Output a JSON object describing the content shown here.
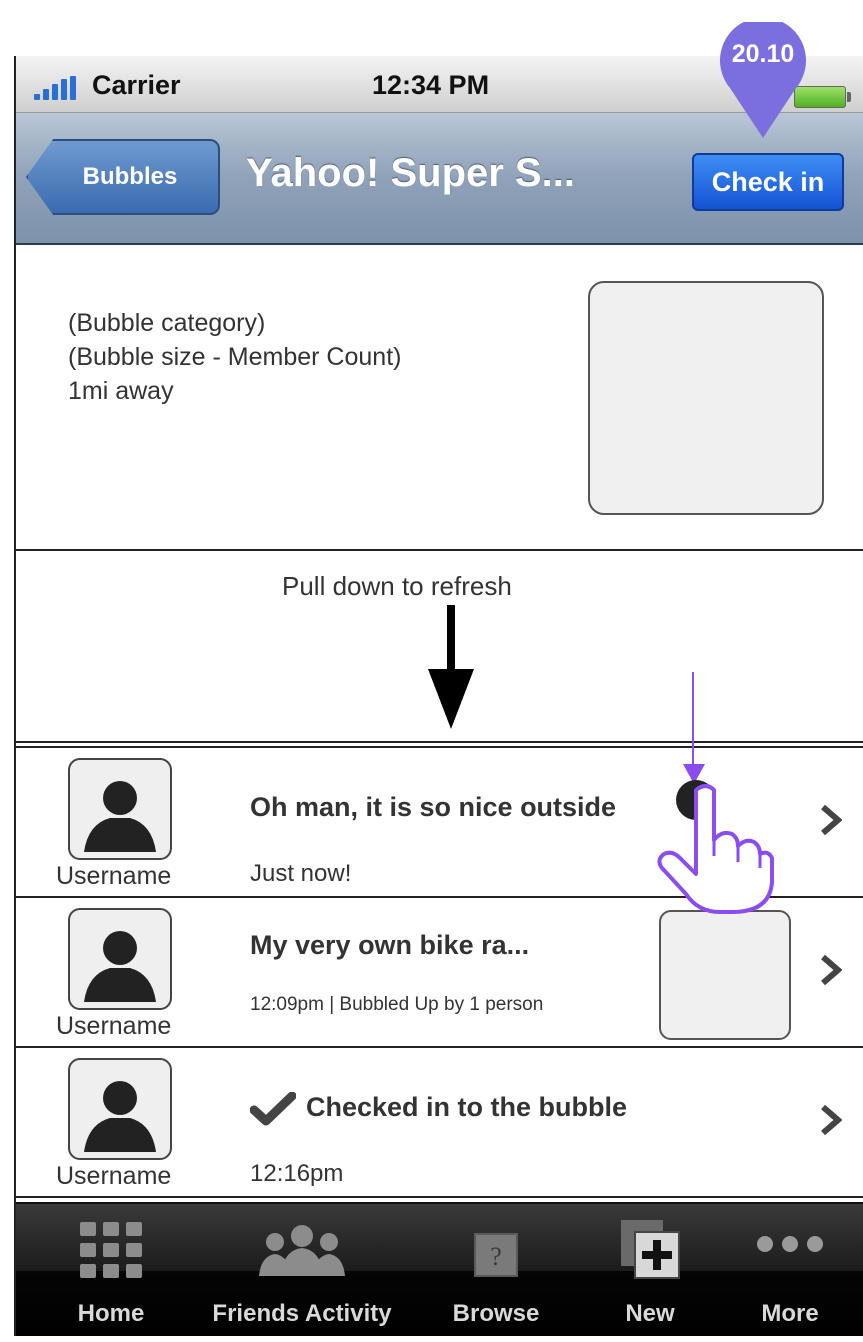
{
  "status_bar": {
    "carrier": "Carrier",
    "time": "12:34 PM",
    "signal_icon": "signal-bars-icon",
    "battery_icon": "battery-icon"
  },
  "nav_bar": {
    "back_label": "Bubbles",
    "title": "Yahoo! Super S...",
    "checkin_label": "Check in"
  },
  "bubble_info": {
    "category": "(Bubble category)",
    "size": "(Bubble size - Member Count)",
    "distance": "1mi away"
  },
  "refresh": {
    "label": "Pull down to refresh",
    "icon": "arrow-down-icon"
  },
  "feed": [
    {
      "username": "Username",
      "title": "Oh man, it is so nice outside",
      "subtitle": "Just now!"
    },
    {
      "username": "Username",
      "title": "My very own bike ra...",
      "subtitle": "12:09pm | Bubbled Up by 1 person"
    },
    {
      "username": "Username",
      "title": "Checked in to the bubble",
      "subtitle": "12:16pm",
      "icon": "checkmark-icon"
    }
  ],
  "tab_bar": {
    "tabs": [
      {
        "label": "Home",
        "icon": "grid-icon"
      },
      {
        "label": "Friends Activity",
        "icon": "people-icon"
      },
      {
        "label": "Browse",
        "icon": "question-box-icon"
      },
      {
        "label": "New",
        "icon": "add-page-icon"
      },
      {
        "label": "More",
        "icon": "ellipsis-icon"
      }
    ]
  },
  "annotations": {
    "pin_label": "20.10",
    "accent_color": "#7b6fe0",
    "tap_color": "#8a4df0"
  }
}
